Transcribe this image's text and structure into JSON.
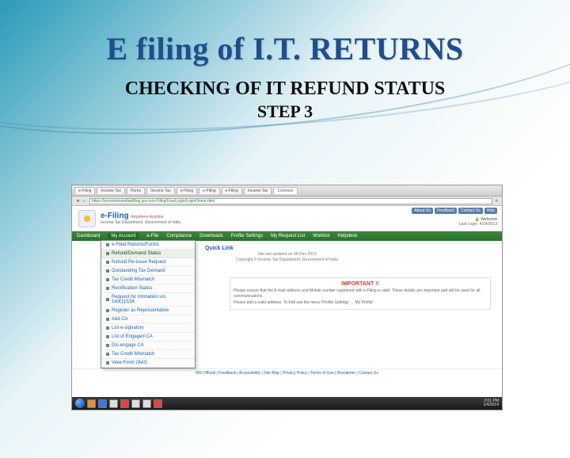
{
  "slide": {
    "title": "E filing of I.T. RETURNS",
    "subtitle": "CHECKING OF IT REFUND STATUS",
    "step": "STEP 3"
  },
  "browser": {
    "tabs": [
      "e-Filing",
      "Income Tax",
      "Home",
      "Income Tax",
      "e-Filing",
      "e-Filing",
      "e-Filing",
      "Income Tax",
      "Common"
    ],
    "url": "https://incometaxindiaefiling.gov.in/e-Filing/UserLogin/LoginHome.html"
  },
  "header": {
    "brand": "e-Filing",
    "brand_sub": "Anywhere Anytime",
    "brand_line": "Income Tax Department, Government of India",
    "top_links": [
      "About Us",
      "Feedback",
      "Contact Us",
      "Help"
    ],
    "welcome": "Welcome",
    "last_login": "Last Login: 4/24/2013"
  },
  "menu": {
    "items": [
      "Dashboard",
      "My Account",
      "e-File",
      "Compliance",
      "Downloads",
      "Profile Settings",
      "My Request List",
      "Worklist",
      "Helpdesk"
    ],
    "active_index": 1
  },
  "dropdown": {
    "items": [
      "e-Filed Returns/Forms",
      "Refund/Demand Status",
      "Refund Re-issue Request",
      "Outstanding Tax Demand",
      "Tax Credit Mismatch",
      "Rectification Status",
      "Request for Intimation u/s 143(1)/154",
      "Register as Representative",
      "Add CA",
      "List e-signatory",
      "List of Engaged CA",
      "Dis-engage CA",
      "Tax Credit Mismatch",
      "View Form 26AS"
    ],
    "highlight_index": 1
  },
  "content": {
    "quick_links": "Quick Link",
    "important_hdr": "IMPORTANT !!",
    "important_line1": "Please ensure that the E-mail address and Mobile number registered with e-Filing is valid. These details are important and will be used for all communications.",
    "important_line2": "Please add a valid address. To Edit use the menu 'Profile Settings → My Profile'."
  },
  "footer": {
    "links": "IRS Official | Feedback | Accessibility | Site Map | Privacy Policy | Terms of Use | Disclaimer | Contact Us",
    "note": "Site last updated on 06-Dec-2013",
    "copyright": "Copyright © Income Tax Department, Government of India"
  },
  "taskbar": {
    "time": "2:01 PM",
    "date": "1/4/2014"
  }
}
